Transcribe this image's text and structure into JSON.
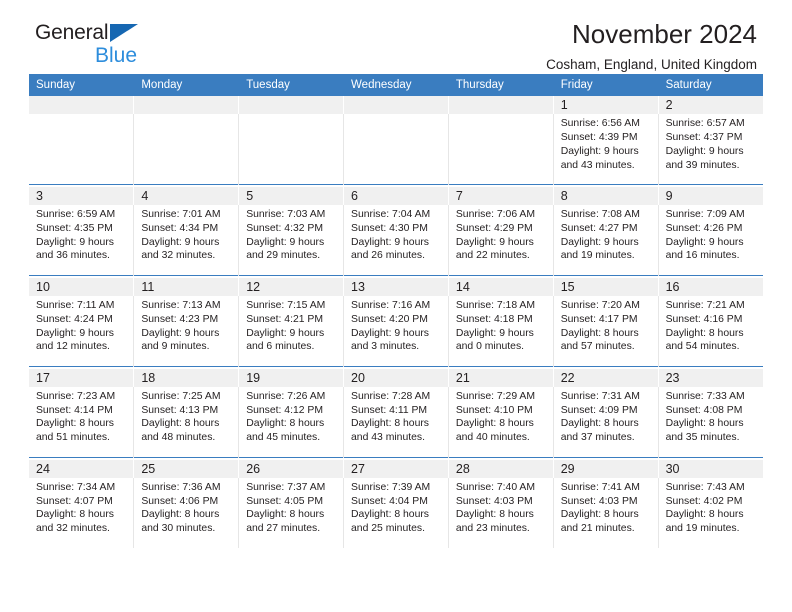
{
  "brand": {
    "name_part1": "General",
    "name_part2": "Blue",
    "triangle_color": "#1667b2",
    "blue_text_color": "#2d8ddc"
  },
  "header": {
    "title": "November 2024",
    "subtitle": "Cosham, England, United Kingdom"
  },
  "theme": {
    "header_blue": "#3a7dc0",
    "daynum_gray": "#f0f0f0",
    "text": "#231f20"
  },
  "weekdays": [
    "Sunday",
    "Monday",
    "Tuesday",
    "Wednesday",
    "Thursday",
    "Friday",
    "Saturday"
  ],
  "weeks": [
    {
      "days": [
        {
          "num": "",
          "sunrise": "",
          "sunset": "",
          "daylight_line1": "",
          "daylight_line2": ""
        },
        {
          "num": "",
          "sunrise": "",
          "sunset": "",
          "daylight_line1": "",
          "daylight_line2": ""
        },
        {
          "num": "",
          "sunrise": "",
          "sunset": "",
          "daylight_line1": "",
          "daylight_line2": ""
        },
        {
          "num": "",
          "sunrise": "",
          "sunset": "",
          "daylight_line1": "",
          "daylight_line2": ""
        },
        {
          "num": "",
          "sunrise": "",
          "sunset": "",
          "daylight_line1": "",
          "daylight_line2": ""
        },
        {
          "num": "1",
          "sunrise": "Sunrise: 6:56 AM",
          "sunset": "Sunset: 4:39 PM",
          "daylight_line1": "Daylight: 9 hours",
          "daylight_line2": "and 43 minutes."
        },
        {
          "num": "2",
          "sunrise": "Sunrise: 6:57 AM",
          "sunset": "Sunset: 4:37 PM",
          "daylight_line1": "Daylight: 9 hours",
          "daylight_line2": "and 39 minutes."
        }
      ]
    },
    {
      "days": [
        {
          "num": "3",
          "sunrise": "Sunrise: 6:59 AM",
          "sunset": "Sunset: 4:35 PM",
          "daylight_line1": "Daylight: 9 hours",
          "daylight_line2": "and 36 minutes."
        },
        {
          "num": "4",
          "sunrise": "Sunrise: 7:01 AM",
          "sunset": "Sunset: 4:34 PM",
          "daylight_line1": "Daylight: 9 hours",
          "daylight_line2": "and 32 minutes."
        },
        {
          "num": "5",
          "sunrise": "Sunrise: 7:03 AM",
          "sunset": "Sunset: 4:32 PM",
          "daylight_line1": "Daylight: 9 hours",
          "daylight_line2": "and 29 minutes."
        },
        {
          "num": "6",
          "sunrise": "Sunrise: 7:04 AM",
          "sunset": "Sunset: 4:30 PM",
          "daylight_line1": "Daylight: 9 hours",
          "daylight_line2": "and 26 minutes."
        },
        {
          "num": "7",
          "sunrise": "Sunrise: 7:06 AM",
          "sunset": "Sunset: 4:29 PM",
          "daylight_line1": "Daylight: 9 hours",
          "daylight_line2": "and 22 minutes."
        },
        {
          "num": "8",
          "sunrise": "Sunrise: 7:08 AM",
          "sunset": "Sunset: 4:27 PM",
          "daylight_line1": "Daylight: 9 hours",
          "daylight_line2": "and 19 minutes."
        },
        {
          "num": "9",
          "sunrise": "Sunrise: 7:09 AM",
          "sunset": "Sunset: 4:26 PM",
          "daylight_line1": "Daylight: 9 hours",
          "daylight_line2": "and 16 minutes."
        }
      ]
    },
    {
      "days": [
        {
          "num": "10",
          "sunrise": "Sunrise: 7:11 AM",
          "sunset": "Sunset: 4:24 PM",
          "daylight_line1": "Daylight: 9 hours",
          "daylight_line2": "and 12 minutes."
        },
        {
          "num": "11",
          "sunrise": "Sunrise: 7:13 AM",
          "sunset": "Sunset: 4:23 PM",
          "daylight_line1": "Daylight: 9 hours",
          "daylight_line2": "and 9 minutes."
        },
        {
          "num": "12",
          "sunrise": "Sunrise: 7:15 AM",
          "sunset": "Sunset: 4:21 PM",
          "daylight_line1": "Daylight: 9 hours",
          "daylight_line2": "and 6 minutes."
        },
        {
          "num": "13",
          "sunrise": "Sunrise: 7:16 AM",
          "sunset": "Sunset: 4:20 PM",
          "daylight_line1": "Daylight: 9 hours",
          "daylight_line2": "and 3 minutes."
        },
        {
          "num": "14",
          "sunrise": "Sunrise: 7:18 AM",
          "sunset": "Sunset: 4:18 PM",
          "daylight_line1": "Daylight: 9 hours",
          "daylight_line2": "and 0 minutes."
        },
        {
          "num": "15",
          "sunrise": "Sunrise: 7:20 AM",
          "sunset": "Sunset: 4:17 PM",
          "daylight_line1": "Daylight: 8 hours",
          "daylight_line2": "and 57 minutes."
        },
        {
          "num": "16",
          "sunrise": "Sunrise: 7:21 AM",
          "sunset": "Sunset: 4:16 PM",
          "daylight_line1": "Daylight: 8 hours",
          "daylight_line2": "and 54 minutes."
        }
      ]
    },
    {
      "days": [
        {
          "num": "17",
          "sunrise": "Sunrise: 7:23 AM",
          "sunset": "Sunset: 4:14 PM",
          "daylight_line1": "Daylight: 8 hours",
          "daylight_line2": "and 51 minutes."
        },
        {
          "num": "18",
          "sunrise": "Sunrise: 7:25 AM",
          "sunset": "Sunset: 4:13 PM",
          "daylight_line1": "Daylight: 8 hours",
          "daylight_line2": "and 48 minutes."
        },
        {
          "num": "19",
          "sunrise": "Sunrise: 7:26 AM",
          "sunset": "Sunset: 4:12 PM",
          "daylight_line1": "Daylight: 8 hours",
          "daylight_line2": "and 45 minutes."
        },
        {
          "num": "20",
          "sunrise": "Sunrise: 7:28 AM",
          "sunset": "Sunset: 4:11 PM",
          "daylight_line1": "Daylight: 8 hours",
          "daylight_line2": "and 43 minutes."
        },
        {
          "num": "21",
          "sunrise": "Sunrise: 7:29 AM",
          "sunset": "Sunset: 4:10 PM",
          "daylight_line1": "Daylight: 8 hours",
          "daylight_line2": "and 40 minutes."
        },
        {
          "num": "22",
          "sunrise": "Sunrise: 7:31 AM",
          "sunset": "Sunset: 4:09 PM",
          "daylight_line1": "Daylight: 8 hours",
          "daylight_line2": "and 37 minutes."
        },
        {
          "num": "23",
          "sunrise": "Sunrise: 7:33 AM",
          "sunset": "Sunset: 4:08 PM",
          "daylight_line1": "Daylight: 8 hours",
          "daylight_line2": "and 35 minutes."
        }
      ]
    },
    {
      "days": [
        {
          "num": "24",
          "sunrise": "Sunrise: 7:34 AM",
          "sunset": "Sunset: 4:07 PM",
          "daylight_line1": "Daylight: 8 hours",
          "daylight_line2": "and 32 minutes."
        },
        {
          "num": "25",
          "sunrise": "Sunrise: 7:36 AM",
          "sunset": "Sunset: 4:06 PM",
          "daylight_line1": "Daylight: 8 hours",
          "daylight_line2": "and 30 minutes."
        },
        {
          "num": "26",
          "sunrise": "Sunrise: 7:37 AM",
          "sunset": "Sunset: 4:05 PM",
          "daylight_line1": "Daylight: 8 hours",
          "daylight_line2": "and 27 minutes."
        },
        {
          "num": "27",
          "sunrise": "Sunrise: 7:39 AM",
          "sunset": "Sunset: 4:04 PM",
          "daylight_line1": "Daylight: 8 hours",
          "daylight_line2": "and 25 minutes."
        },
        {
          "num": "28",
          "sunrise": "Sunrise: 7:40 AM",
          "sunset": "Sunset: 4:03 PM",
          "daylight_line1": "Daylight: 8 hours",
          "daylight_line2": "and 23 minutes."
        },
        {
          "num": "29",
          "sunrise": "Sunrise: 7:41 AM",
          "sunset": "Sunset: 4:03 PM",
          "daylight_line1": "Daylight: 8 hours",
          "daylight_line2": "and 21 minutes."
        },
        {
          "num": "30",
          "sunrise": "Sunrise: 7:43 AM",
          "sunset": "Sunset: 4:02 PM",
          "daylight_line1": "Daylight: 8 hours",
          "daylight_line2": "and 19 minutes."
        }
      ]
    }
  ]
}
